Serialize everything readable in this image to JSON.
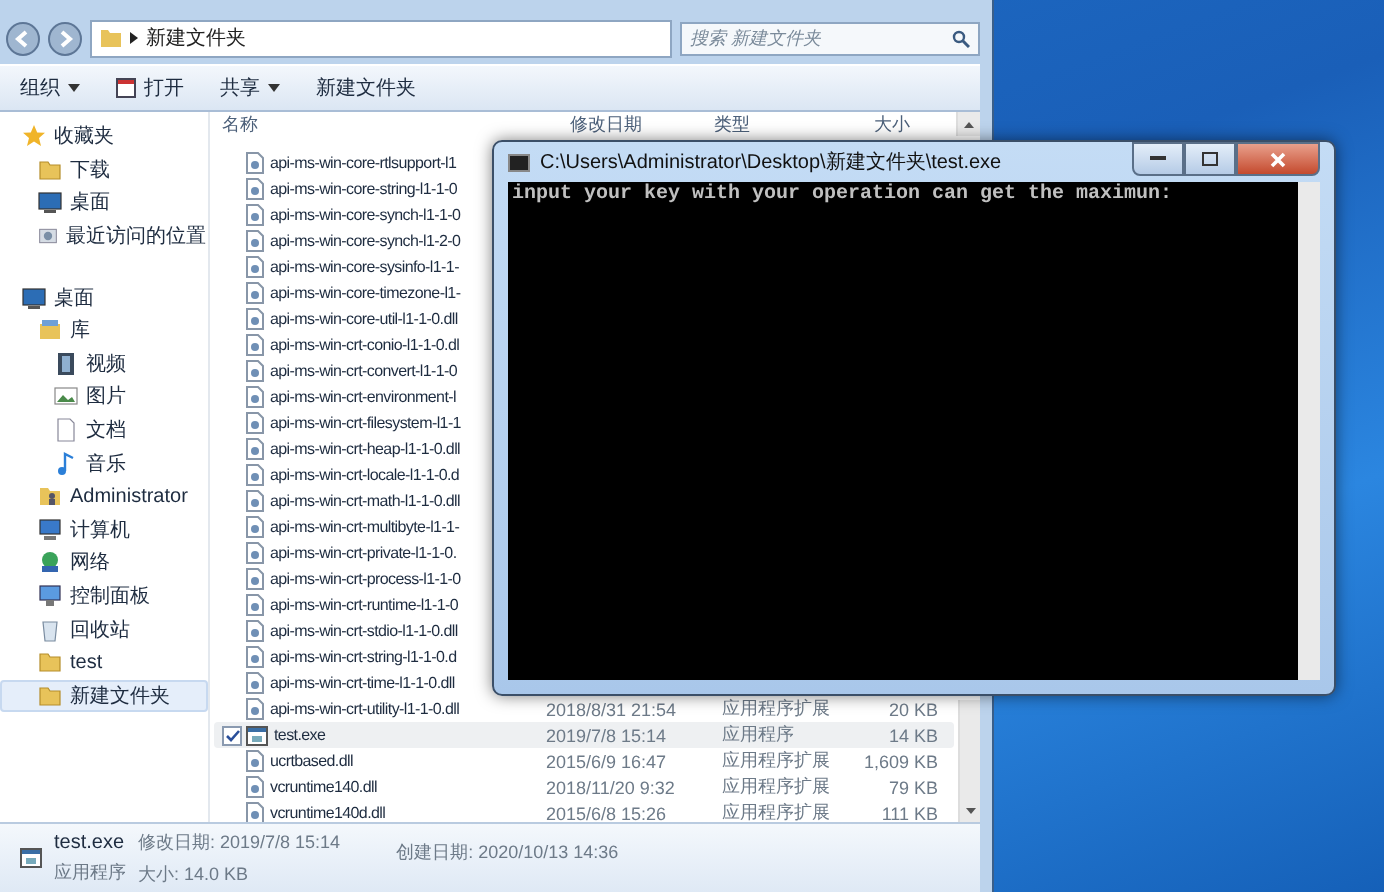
{
  "explorer": {
    "address": {
      "path": "新建文件夹",
      "search_placeholder": "搜索 新建文件夹"
    },
    "toolbar": [
      {
        "label": "组织",
        "kind": "menu"
      },
      {
        "label": "打开",
        "kind": "open"
      },
      {
        "label": "共享",
        "kind": "menu"
      },
      {
        "label": "新建文件夹",
        "kind": "plain"
      }
    ],
    "nav": [
      {
        "label": "收藏夹",
        "kind": "star",
        "selected": false,
        "children": [
          {
            "label": "下载",
            "kind": "folder",
            "selected": false
          },
          {
            "label": "桌面",
            "kind": "desktop",
            "selected": false
          },
          {
            "label": "最近访问的位置",
            "kind": "recent",
            "selected": false
          }
        ]
      },
      {
        "label": "桌面",
        "kind": "desktop",
        "selected": false,
        "children": [
          {
            "label": "库",
            "kind": "library",
            "selected": false,
            "children": [
              {
                "label": "视频",
                "kind": "video",
                "selected": false
              },
              {
                "label": "图片",
                "kind": "picture",
                "selected": false
              },
              {
                "label": "文档",
                "kind": "document",
                "selected": false
              },
              {
                "label": "音乐",
                "kind": "music",
                "selected": false
              }
            ]
          },
          {
            "label": "Administrator",
            "kind": "user",
            "selected": false
          },
          {
            "label": "计算机",
            "kind": "computer",
            "selected": false
          },
          {
            "label": "网络",
            "kind": "network",
            "selected": false
          },
          {
            "label": "控制面板",
            "kind": "control",
            "selected": false
          },
          {
            "label": "回收站",
            "kind": "recycle",
            "selected": false
          },
          {
            "label": "test",
            "kind": "folder",
            "selected": false
          },
          {
            "label": "新建文件夹",
            "kind": "folder",
            "selected": true
          }
        ]
      }
    ],
    "columns": [
      "名称",
      "修改日期",
      "类型",
      "大小"
    ],
    "rows": [
      {
        "name": "api-ms-win-core-rtlsupport-l1",
        "kind": "dll",
        "selected": false
      },
      {
        "name": "api-ms-win-core-string-l1-1-0",
        "kind": "dll",
        "selected": false
      },
      {
        "name": "api-ms-win-core-synch-l1-1-0",
        "kind": "dll",
        "selected": false
      },
      {
        "name": "api-ms-win-core-synch-l1-2-0",
        "kind": "dll",
        "selected": false
      },
      {
        "name": "api-ms-win-core-sysinfo-l1-1-",
        "kind": "dll",
        "selected": false
      },
      {
        "name": "api-ms-win-core-timezone-l1-",
        "kind": "dll",
        "selected": false
      },
      {
        "name": "api-ms-win-core-util-l1-1-0.dll",
        "kind": "dll",
        "selected": false
      },
      {
        "name": "api-ms-win-crt-conio-l1-1-0.dl",
        "kind": "dll",
        "selected": false
      },
      {
        "name": "api-ms-win-crt-convert-l1-1-0",
        "kind": "dll",
        "selected": false
      },
      {
        "name": "api-ms-win-crt-environment-l",
        "kind": "dll",
        "selected": false
      },
      {
        "name": "api-ms-win-crt-filesystem-l1-1",
        "kind": "dll",
        "selected": false
      },
      {
        "name": "api-ms-win-crt-heap-l1-1-0.dll",
        "kind": "dll",
        "selected": false
      },
      {
        "name": "api-ms-win-crt-locale-l1-1-0.d",
        "kind": "dll",
        "selected": false
      },
      {
        "name": "api-ms-win-crt-math-l1-1-0.dll",
        "kind": "dll",
        "selected": false
      },
      {
        "name": "api-ms-win-crt-multibyte-l1-1-",
        "kind": "dll",
        "selected": false
      },
      {
        "name": "api-ms-win-crt-private-l1-1-0.",
        "kind": "dll",
        "selected": false
      },
      {
        "name": "api-ms-win-crt-process-l1-1-0",
        "kind": "dll",
        "selected": false
      },
      {
        "name": "api-ms-win-crt-runtime-l1-1-0",
        "kind": "dll",
        "selected": false
      },
      {
        "name": "api-ms-win-crt-stdio-l1-1-0.dll",
        "kind": "dll",
        "selected": false
      },
      {
        "name": "api-ms-win-crt-string-l1-1-0.d",
        "kind": "dll",
        "selected": false
      },
      {
        "name": "api-ms-win-crt-time-l1-1-0.dll",
        "kind": "dll",
        "selected": false
      },
      {
        "name": "api-ms-win-crt-utility-l1-1-0.dll",
        "date": "2018/8/31 21:54",
        "type": "应用程序扩展",
        "size": "20 KB",
        "kind": "dll",
        "selected": false
      },
      {
        "name": "test.exe",
        "date": "2019/7/8 15:14",
        "type": "应用程序",
        "size": "14 KB",
        "kind": "exe",
        "selected": true
      },
      {
        "name": "ucrtbased.dll",
        "date": "2015/6/9 16:47",
        "type": "应用程序扩展",
        "size": "1,609 KB",
        "kind": "dll",
        "selected": false
      },
      {
        "name": "vcruntime140.dll",
        "date": "2018/11/20 9:32",
        "type": "应用程序扩展",
        "size": "79 KB",
        "kind": "dll",
        "selected": false
      },
      {
        "name": "vcruntime140d.dll",
        "date": "2015/6/8 15:26",
        "type": "应用程序扩展",
        "size": "111 KB",
        "kind": "dll",
        "selected": false
      }
    ],
    "details": {
      "name": "test.exe",
      "type": "应用程序",
      "modified": "修改日期: 2019/7/8 15:14",
      "size": "大小: 14.0 KB",
      "created": "创建日期: 2020/10/13 14:36"
    }
  },
  "console": {
    "title": "C:\\Users\\Administrator\\Desktop\\新建文件夹\\test.exe",
    "output": "input your key with your operation can get the maximun:"
  }
}
